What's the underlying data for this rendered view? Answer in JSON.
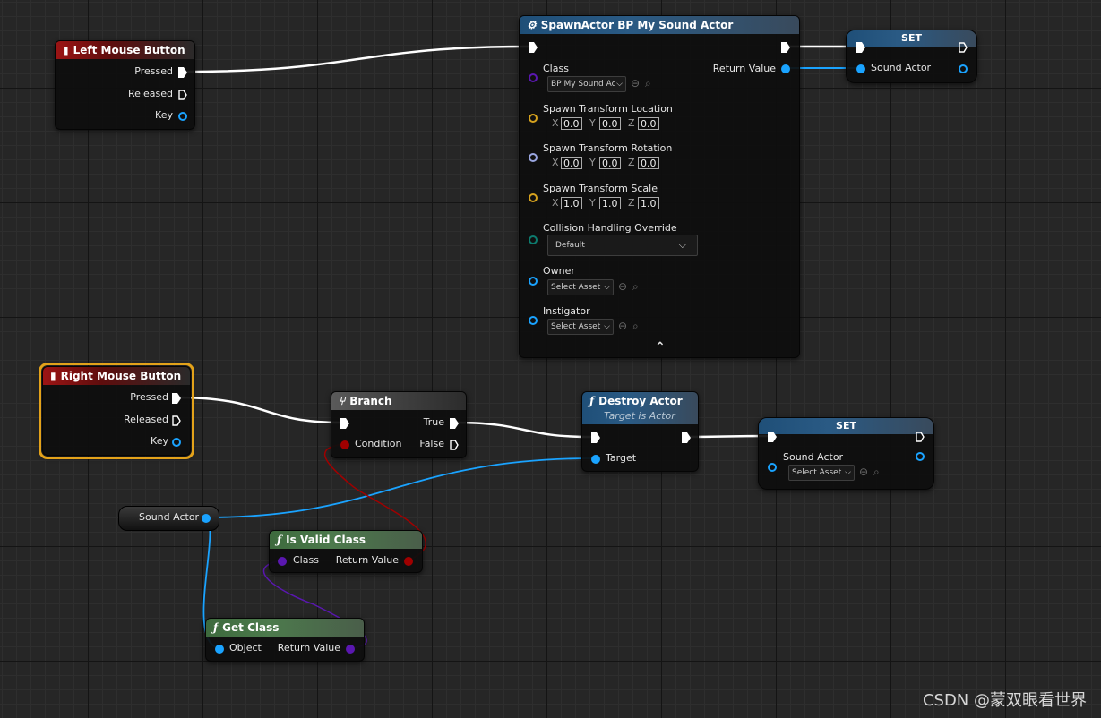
{
  "nodes": {
    "left_mouse": {
      "title": "Left Mouse Button",
      "pins": [
        "Pressed",
        "Released",
        "Key"
      ]
    },
    "spawn": {
      "title": "SpawnActor BP My Sound Actor",
      "class_label": "Class",
      "class_value": "BP My Sound Ac",
      "return_label": "Return Value",
      "loc_label": "Spawn Transform Location",
      "rot_label": "Spawn Transform Rotation",
      "scale_label": "Spawn Transform Scale",
      "loc": [
        "0.0",
        "0.0",
        "0.0"
      ],
      "rot": [
        "0.0",
        "0.0",
        "0.0"
      ],
      "scale": [
        "1.0",
        "1.0",
        "1.0"
      ],
      "axes": [
        "X",
        "Y",
        "Z"
      ],
      "collision_label": "Collision Handling Override",
      "collision_value": "Default",
      "owner_label": "Owner",
      "owner_value": "Select Asset",
      "instigator_label": "Instigator",
      "instigator_value": "Select Asset",
      "collapse_glyph": "⌃"
    },
    "set_top": {
      "title": "SET",
      "pin": "Sound Actor"
    },
    "right_mouse": {
      "title": "Right Mouse Button",
      "pins": [
        "Pressed",
        "Released",
        "Key"
      ]
    },
    "branch": {
      "title": "Branch",
      "condition": "Condition",
      "true_label": "True",
      "false_label": "False"
    },
    "destroy": {
      "title": "Destroy Actor",
      "subtitle": "Target is Actor",
      "target": "Target"
    },
    "set_bottom": {
      "title": "SET",
      "pin": "Sound Actor",
      "value": "Select Asset"
    },
    "sound_var": {
      "label": "Sound Actor"
    },
    "is_valid": {
      "title": "Is Valid Class",
      "in": "Class",
      "out": "Return Value"
    },
    "get_class": {
      "title": "Get Class",
      "in": "Object",
      "out": "Return Value"
    }
  },
  "icons": {
    "function": "ƒ",
    "mouse": "mouse-icon",
    "spawn": "spawn-icon",
    "branch": "branch-icon"
  },
  "colors": {
    "exec": "#ffffff",
    "object": "#1aa3ff",
    "class": "#5a17b0",
    "bool": "#a00000",
    "struct": "#d6a21e",
    "rotator": "#9aa6e0",
    "byte": "#0d7b6e",
    "selected": "#e3a21a"
  },
  "watermark": "CSDN @蒙双眼看世界"
}
